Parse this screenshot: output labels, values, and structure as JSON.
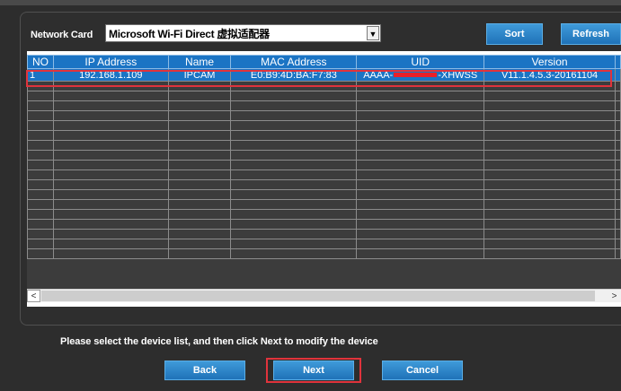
{
  "network_card": {
    "label": "Network Card",
    "selected": "Microsoft Wi-Fi Direct 虚拟适配器"
  },
  "toolbar": {
    "sort_label": "Sort",
    "refresh_label": "Refresh"
  },
  "table": {
    "columns": [
      "NO",
      "IP Address",
      "Name",
      "MAC Address",
      "UID",
      "Version"
    ],
    "rows": [
      {
        "no": "1",
        "ip": "192.168.1.109",
        "name": "IPCAM",
        "mac": "E0:B9:4D:BA:F7:83",
        "uid_prefix": "AAAA-",
        "uid_suffix": "-XHWSS",
        "version": "V11.1.4.5.3-20161104"
      }
    ]
  },
  "hint_text": "Please select the device list, and then click Next to modify the device",
  "footer": {
    "back_label": "Back",
    "next_label": "Next",
    "cancel_label": "Cancel"
  },
  "icons": {
    "dropdown": "chevron-down-icon",
    "scroll_left": "arrow-left-icon",
    "scroll_right": "arrow-right-icon"
  },
  "colors": {
    "background": "#2d2d2d",
    "accent_blue": "#1b74c4",
    "highlight_red": "#e0333c",
    "redaction": "#e8202a"
  }
}
